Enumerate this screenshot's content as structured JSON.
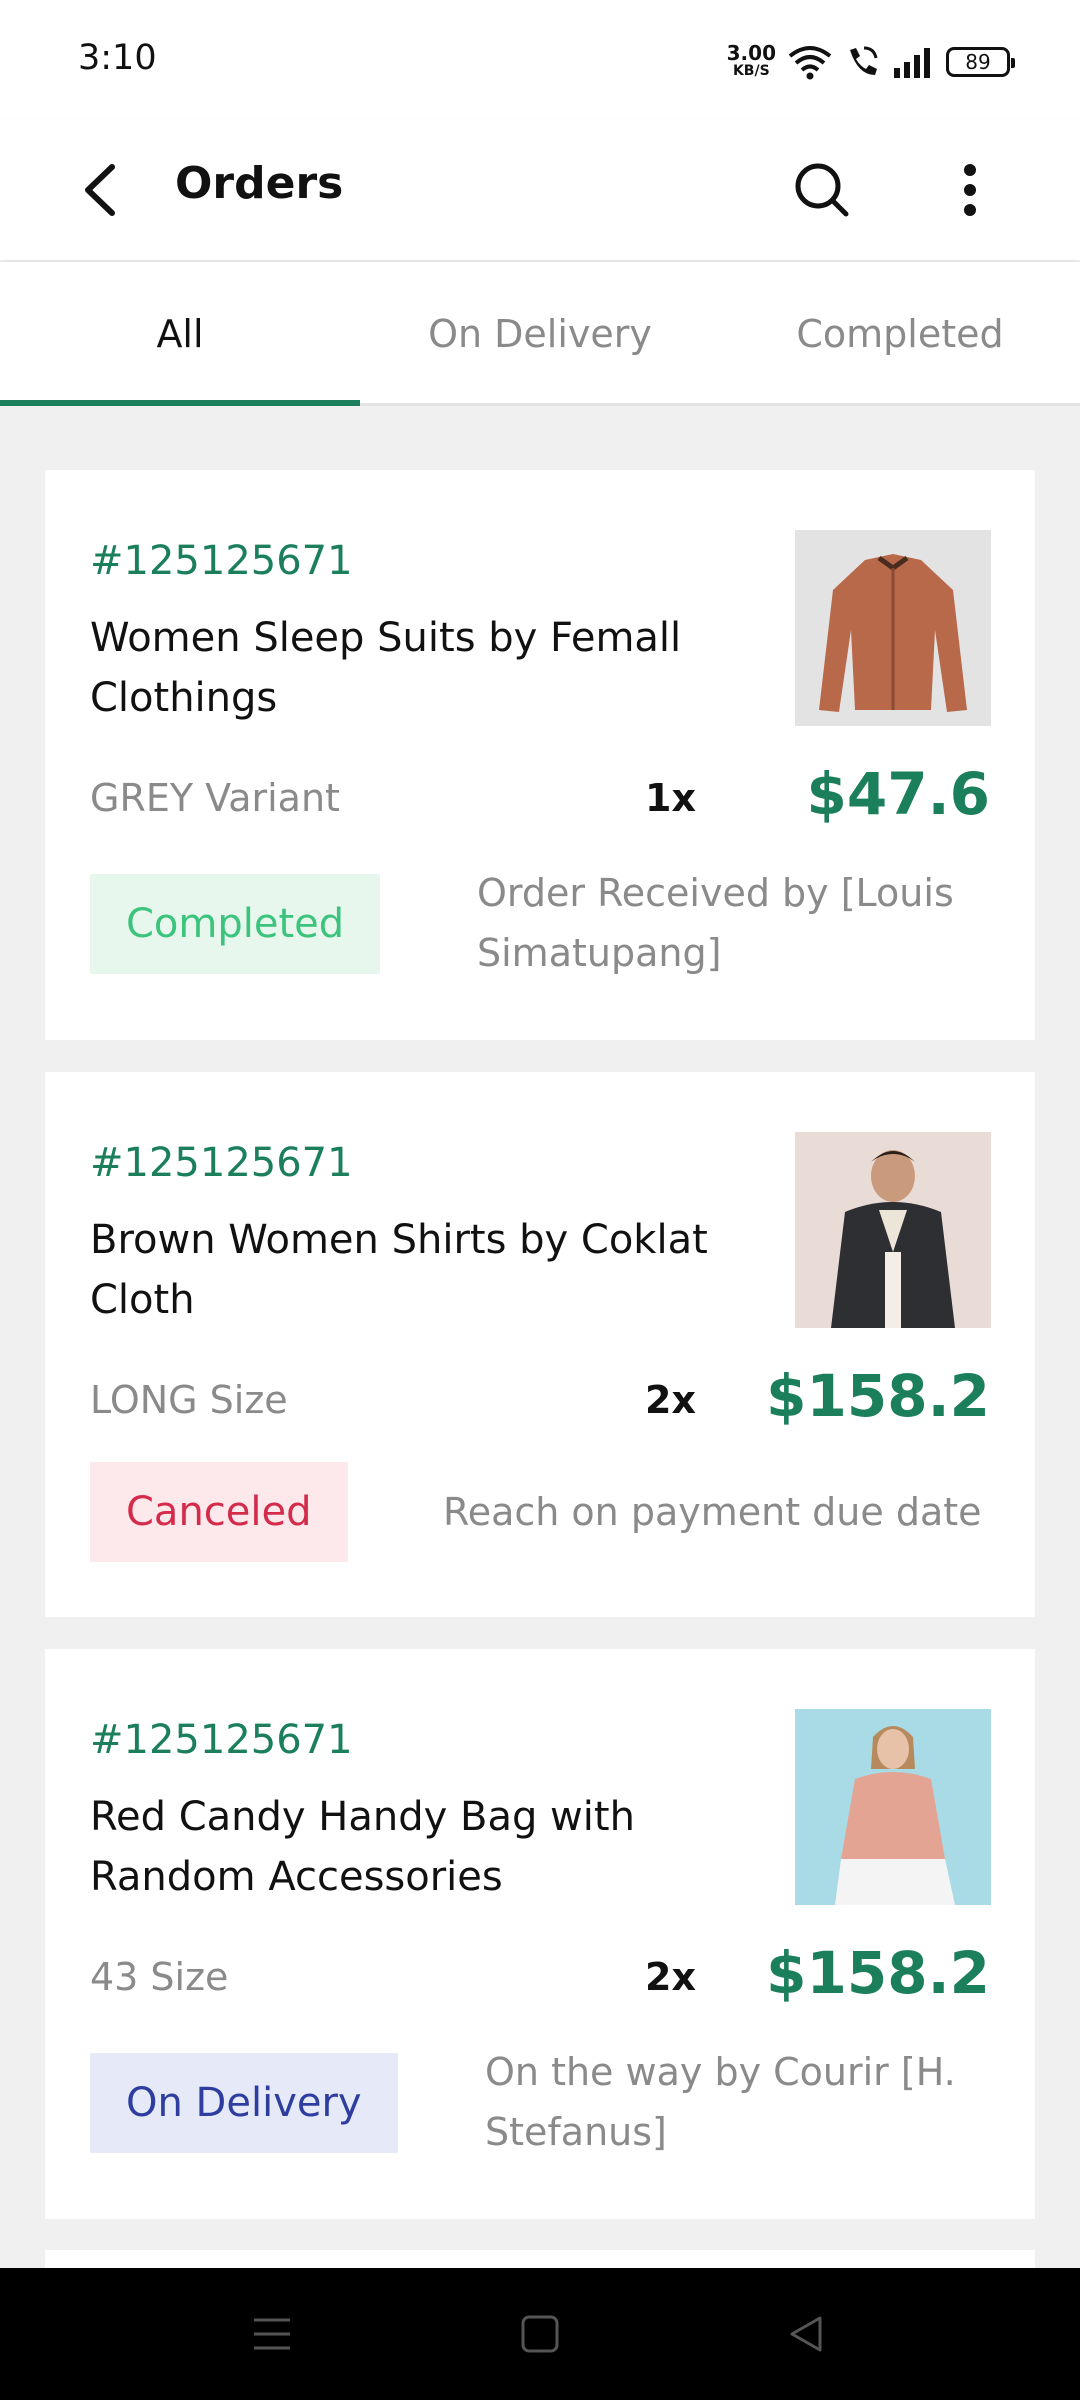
{
  "status_bar": {
    "time": "3:10",
    "net_speed": "3.00",
    "net_unit": "KB/S",
    "battery": "89"
  },
  "app_bar": {
    "title": "Orders",
    "icons": [
      "back-arrow-icon",
      "search-icon",
      "more-vert-icon"
    ]
  },
  "tabs": [
    {
      "label": "All",
      "active": true
    },
    {
      "label": "On Delivery",
      "active": false
    },
    {
      "label": "Completed",
      "active": false
    }
  ],
  "orders": [
    {
      "id": "#125125671",
      "name": "Women Sleep Suits by Femall Clothings",
      "variant": "GREY Variant",
      "qty": "1x",
      "price": "$47.6",
      "status": "Completed",
      "note": "Order Received by [Louis Simatupang]",
      "status_colors": {
        "bg": "#e8f7ee",
        "fg": "#3cc47c"
      }
    },
    {
      "id": "#125125671",
      "name": "Brown Women Shirts by Coklat Cloth",
      "variant": "LONG Size",
      "qty": "2x",
      "price": "$158.2",
      "status": "Canceled",
      "note": "Reach on payment due date",
      "status_colors": {
        "bg": "#fde8ec",
        "fg": "#d52b4b"
      }
    },
    {
      "id": "#125125671",
      "name": "Red Candy Handy Bag with Random Accessories",
      "variant": "43 Size",
      "qty": "2x",
      "price": "$158.2",
      "status": "On Delivery",
      "note": "On the way by Courir  [H. Stefanus]",
      "status_colors": {
        "bg": "#e6e9f7",
        "fg": "#2d3ea0"
      }
    }
  ],
  "colors": {
    "accent": "#1b7f5b",
    "muted_text": "#8a8a8a",
    "background": "#f0f0f0"
  },
  "nav_bar": {
    "icons": [
      "menu-icon",
      "home-square-icon",
      "back-triangle-icon"
    ]
  }
}
